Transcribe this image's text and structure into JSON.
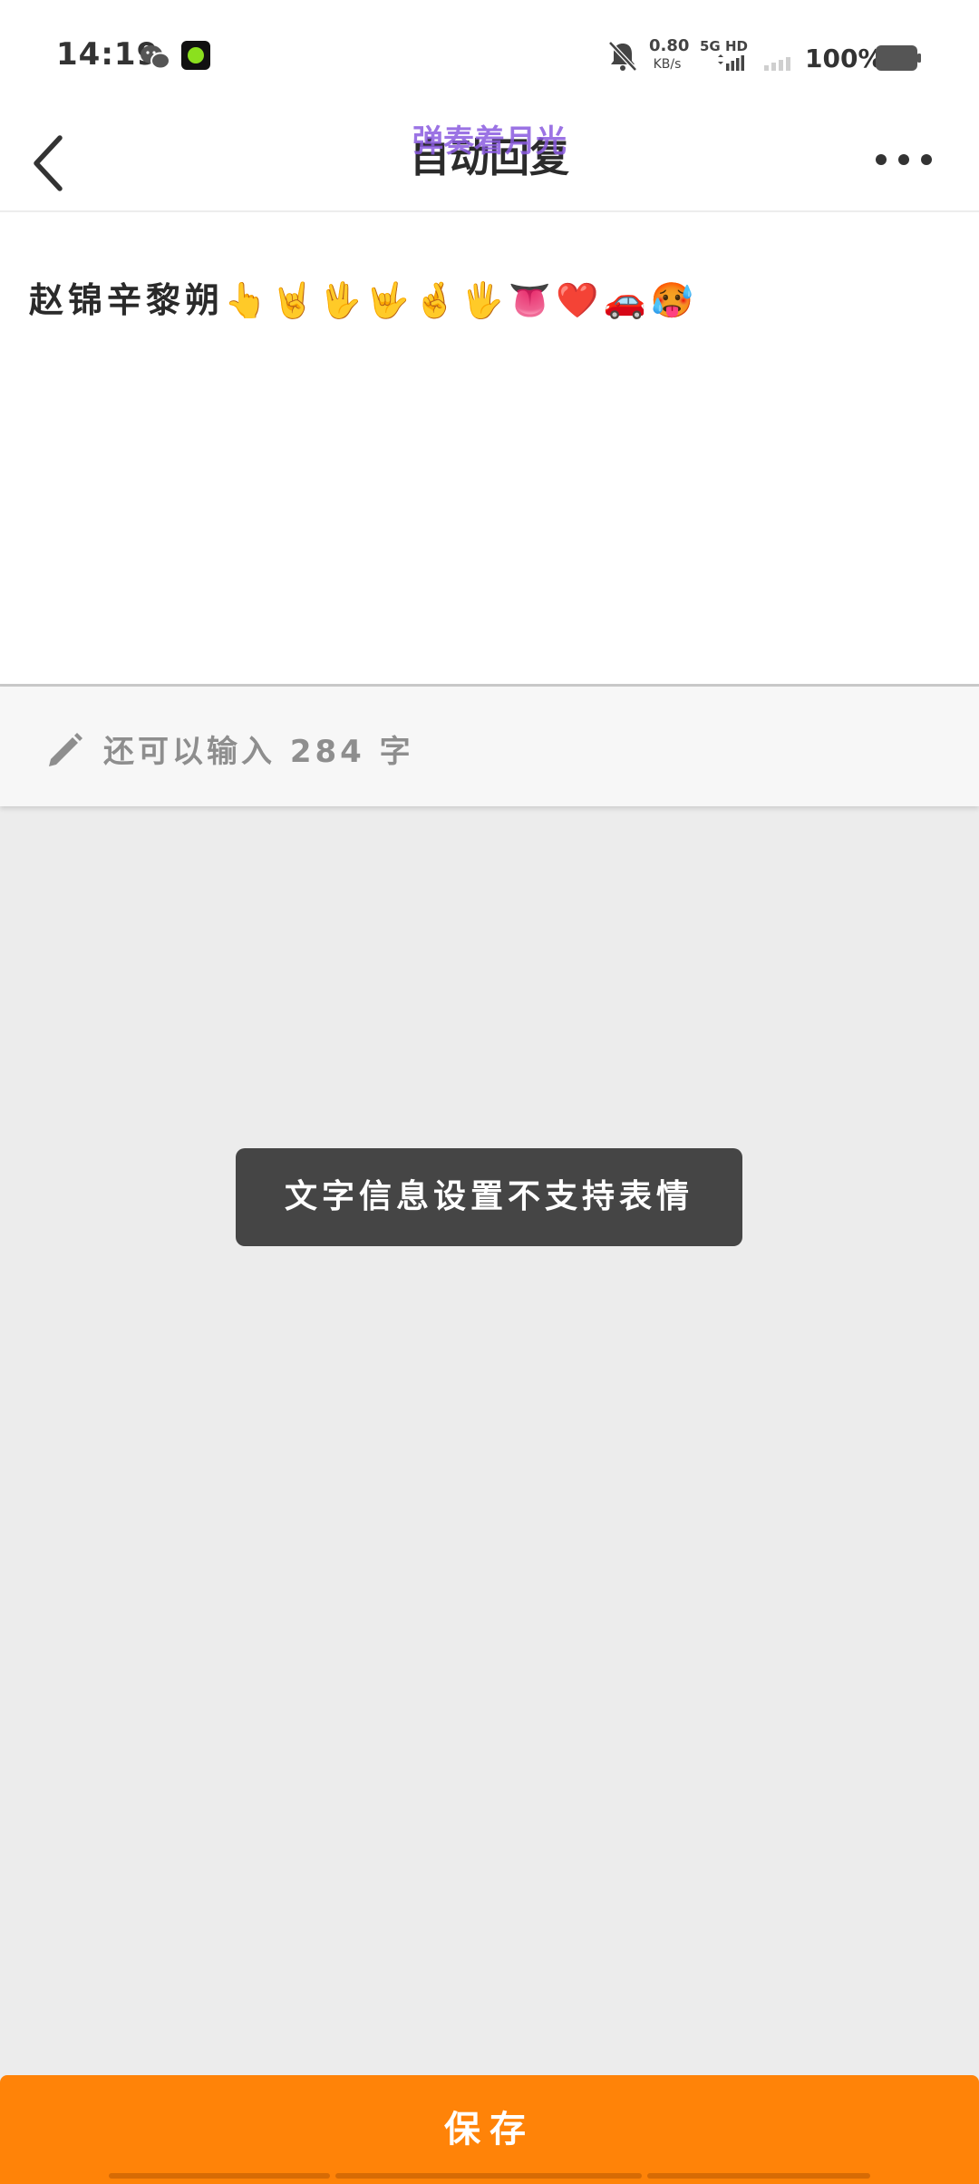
{
  "status_bar": {
    "time": "14:19",
    "net_speed_value": "0.80",
    "net_speed_unit": "KB/s",
    "network_type": "5G HD",
    "battery": "100%",
    "icons": [
      "wechat-icon",
      "app-notification-icon",
      "bell-muted-icon",
      "signal-5g-icon",
      "signal-sim2-icon",
      "battery-icon"
    ]
  },
  "header": {
    "overlay_text": "弹奏着月光",
    "title": "自动回复",
    "back_icon": "chevron-left-icon",
    "more_icon": "more-horizontal-icon"
  },
  "editor": {
    "text": "赵锦辛黎朔👆🤘🖖🤟🤞🖐👅❤️🚗🥵"
  },
  "counter": {
    "icon": "pencil-icon",
    "text": "还可以输入 284 字"
  },
  "toast": {
    "text": "文字信息设置不支持表情"
  },
  "footer": {
    "save_label": "保存"
  },
  "colors": {
    "accent": "#ff8308",
    "overlay_purple": "#8a5be0",
    "toast_bg": "#454545",
    "background": "#ececec"
  }
}
